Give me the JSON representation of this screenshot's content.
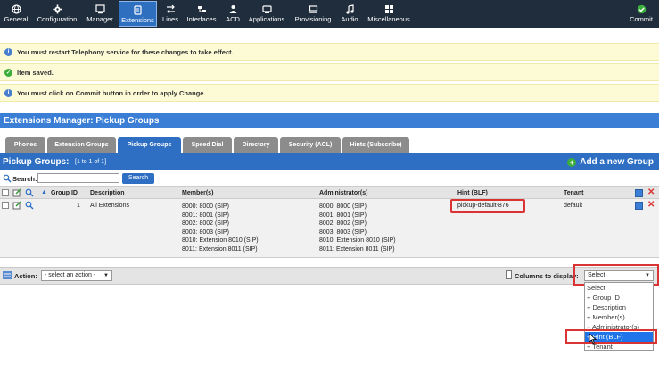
{
  "nav": {
    "items": [
      {
        "label": "General",
        "icon": "globe-icon"
      },
      {
        "label": "Configuration",
        "icon": "gear-icon"
      },
      {
        "label": "Manager",
        "icon": "monitor-icon"
      },
      {
        "label": "Extensions",
        "icon": "phone-book-icon",
        "active": true
      },
      {
        "label": "Lines",
        "icon": "arrows-icon"
      },
      {
        "label": "Interfaces",
        "icon": "interfaces-icon"
      },
      {
        "label": "ACD",
        "icon": "person-icon"
      },
      {
        "label": "Applications",
        "icon": "applications-icon"
      },
      {
        "label": "Provisioning",
        "icon": "provisioning-icon"
      },
      {
        "label": "Audio",
        "icon": "music-icon"
      },
      {
        "label": "Miscellaneous",
        "icon": "grid-icon"
      }
    ],
    "commit": {
      "label": "Commit",
      "icon": "check-circle-icon"
    }
  },
  "messages": [
    {
      "text": "You must restart Telephony service for these changes to take effect.",
      "type": "info"
    },
    {
      "text": "Item saved.",
      "type": "success"
    },
    {
      "text": "You must click on Commit button in order to apply Change.",
      "type": "info"
    }
  ],
  "page_title": "Extensions Manager:  Pickup Groups",
  "tabs": [
    {
      "label": "Phones"
    },
    {
      "label": "Extension Groups"
    },
    {
      "label": "Pickup Groups",
      "active": true
    },
    {
      "label": "Speed Dial"
    },
    {
      "label": "Directory"
    },
    {
      "label": "Security (ACL)"
    },
    {
      "label": "Hints (Subscribe)"
    }
  ],
  "list": {
    "title": "Pickup Groups:",
    "count": "[1 to 1 of 1]",
    "add_label": "Add a new Group"
  },
  "search": {
    "label": "Search:",
    "value": "",
    "button": "Search"
  },
  "table": {
    "headers": {
      "group_id": "Group ID",
      "description": "Description",
      "members": "Member(s)",
      "administrators": "Administrator(s)",
      "hint": "Hint (BLF)",
      "tenant": "Tenant"
    },
    "rows": [
      {
        "group_id": "1",
        "description": "All Extensions",
        "members": [
          "8000: 8000 (SIP)",
          "8001: 8001 (SIP)",
          "8002: 8002 (SIP)",
          "8003: 8003 (SIP)",
          "8010: Extension 8010 (SIP)",
          "8011: Extension 8011 (SIP)"
        ],
        "administrators": [
          "8000: 8000 (SIP)",
          "8001: 8001 (SIP)",
          "8002: 8002 (SIP)",
          "8003: 8003 (SIP)",
          "8010: Extension 8010 (SIP)",
          "8011: Extension 8011 (SIP)"
        ],
        "hint": "pickup-default-876",
        "tenant": "default"
      }
    ]
  },
  "action_bar": {
    "action_label": "Action:",
    "action_value": "- select an action -",
    "columns_label": "Columns to display:",
    "columns_value": "Select",
    "columns_options": [
      "Select",
      "+ Group ID",
      "+ Description",
      "+ Member(s)",
      "+ Administrator(s)",
      "+ Hint (BLF)",
      "+ Tenant"
    ],
    "highlighted_option": "+ Hint (BLF)"
  },
  "colors": {
    "nav_bg": "#1f2d3d",
    "accent": "#2e6fc4",
    "message_bg": "#fdfbd6",
    "highlight_red": "#d93333",
    "selected_option": "#1e74e8"
  }
}
